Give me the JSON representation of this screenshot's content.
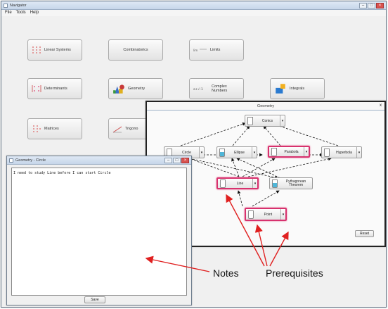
{
  "navigator": {
    "title": "Navigator",
    "menu": [
      "File",
      "Tools",
      "Help"
    ],
    "topics": [
      {
        "label": "Linear Systems",
        "icon": "linear-systems-icon"
      },
      {
        "label": "Combinatorics",
        "icon": "none"
      },
      {
        "label": "Limits",
        "icon": "limits-icon"
      },
      {
        "label": "Determinants",
        "icon": "determinants-icon"
      },
      {
        "label": "Geometry",
        "icon": "geometry-icon"
      },
      {
        "label": "Complex Numbers",
        "icon": "complex-numbers-icon"
      },
      {
        "label": "Integrals",
        "icon": "integrals-icon"
      },
      {
        "label": "Matrices",
        "icon": "matrices-icon"
      },
      {
        "label": "Trigono",
        "icon": "trigonometry-icon"
      }
    ]
  },
  "geometry_window": {
    "title": "Geometry",
    "close": "x",
    "nodes": [
      {
        "label": "Conics",
        "highlight": false,
        "blue": false
      },
      {
        "label": "Circle",
        "highlight": false,
        "blue": false
      },
      {
        "label": "Ellipse",
        "highlight": false,
        "blue": true
      },
      {
        "label": "Parabola",
        "highlight": true,
        "blue": false
      },
      {
        "label": "Hyperbola",
        "highlight": false,
        "blue": false
      },
      {
        "label": "Line",
        "highlight": true,
        "blue": false
      },
      {
        "label": "Pythagorean Theorem",
        "highlight": false,
        "blue": true
      },
      {
        "label": "Point",
        "highlight": true,
        "blue": false
      }
    ],
    "reset_label": "Reset"
  },
  "notes_window": {
    "title": "Geometry - Circle",
    "text": "I need to study Line before I can start Circle",
    "save_label": "Save"
  },
  "annotations": {
    "notes": "Notes",
    "prerequisites": "Prerequisites"
  },
  "colors": {
    "highlight": "#d7326e",
    "arrow_red": "#e02020"
  }
}
